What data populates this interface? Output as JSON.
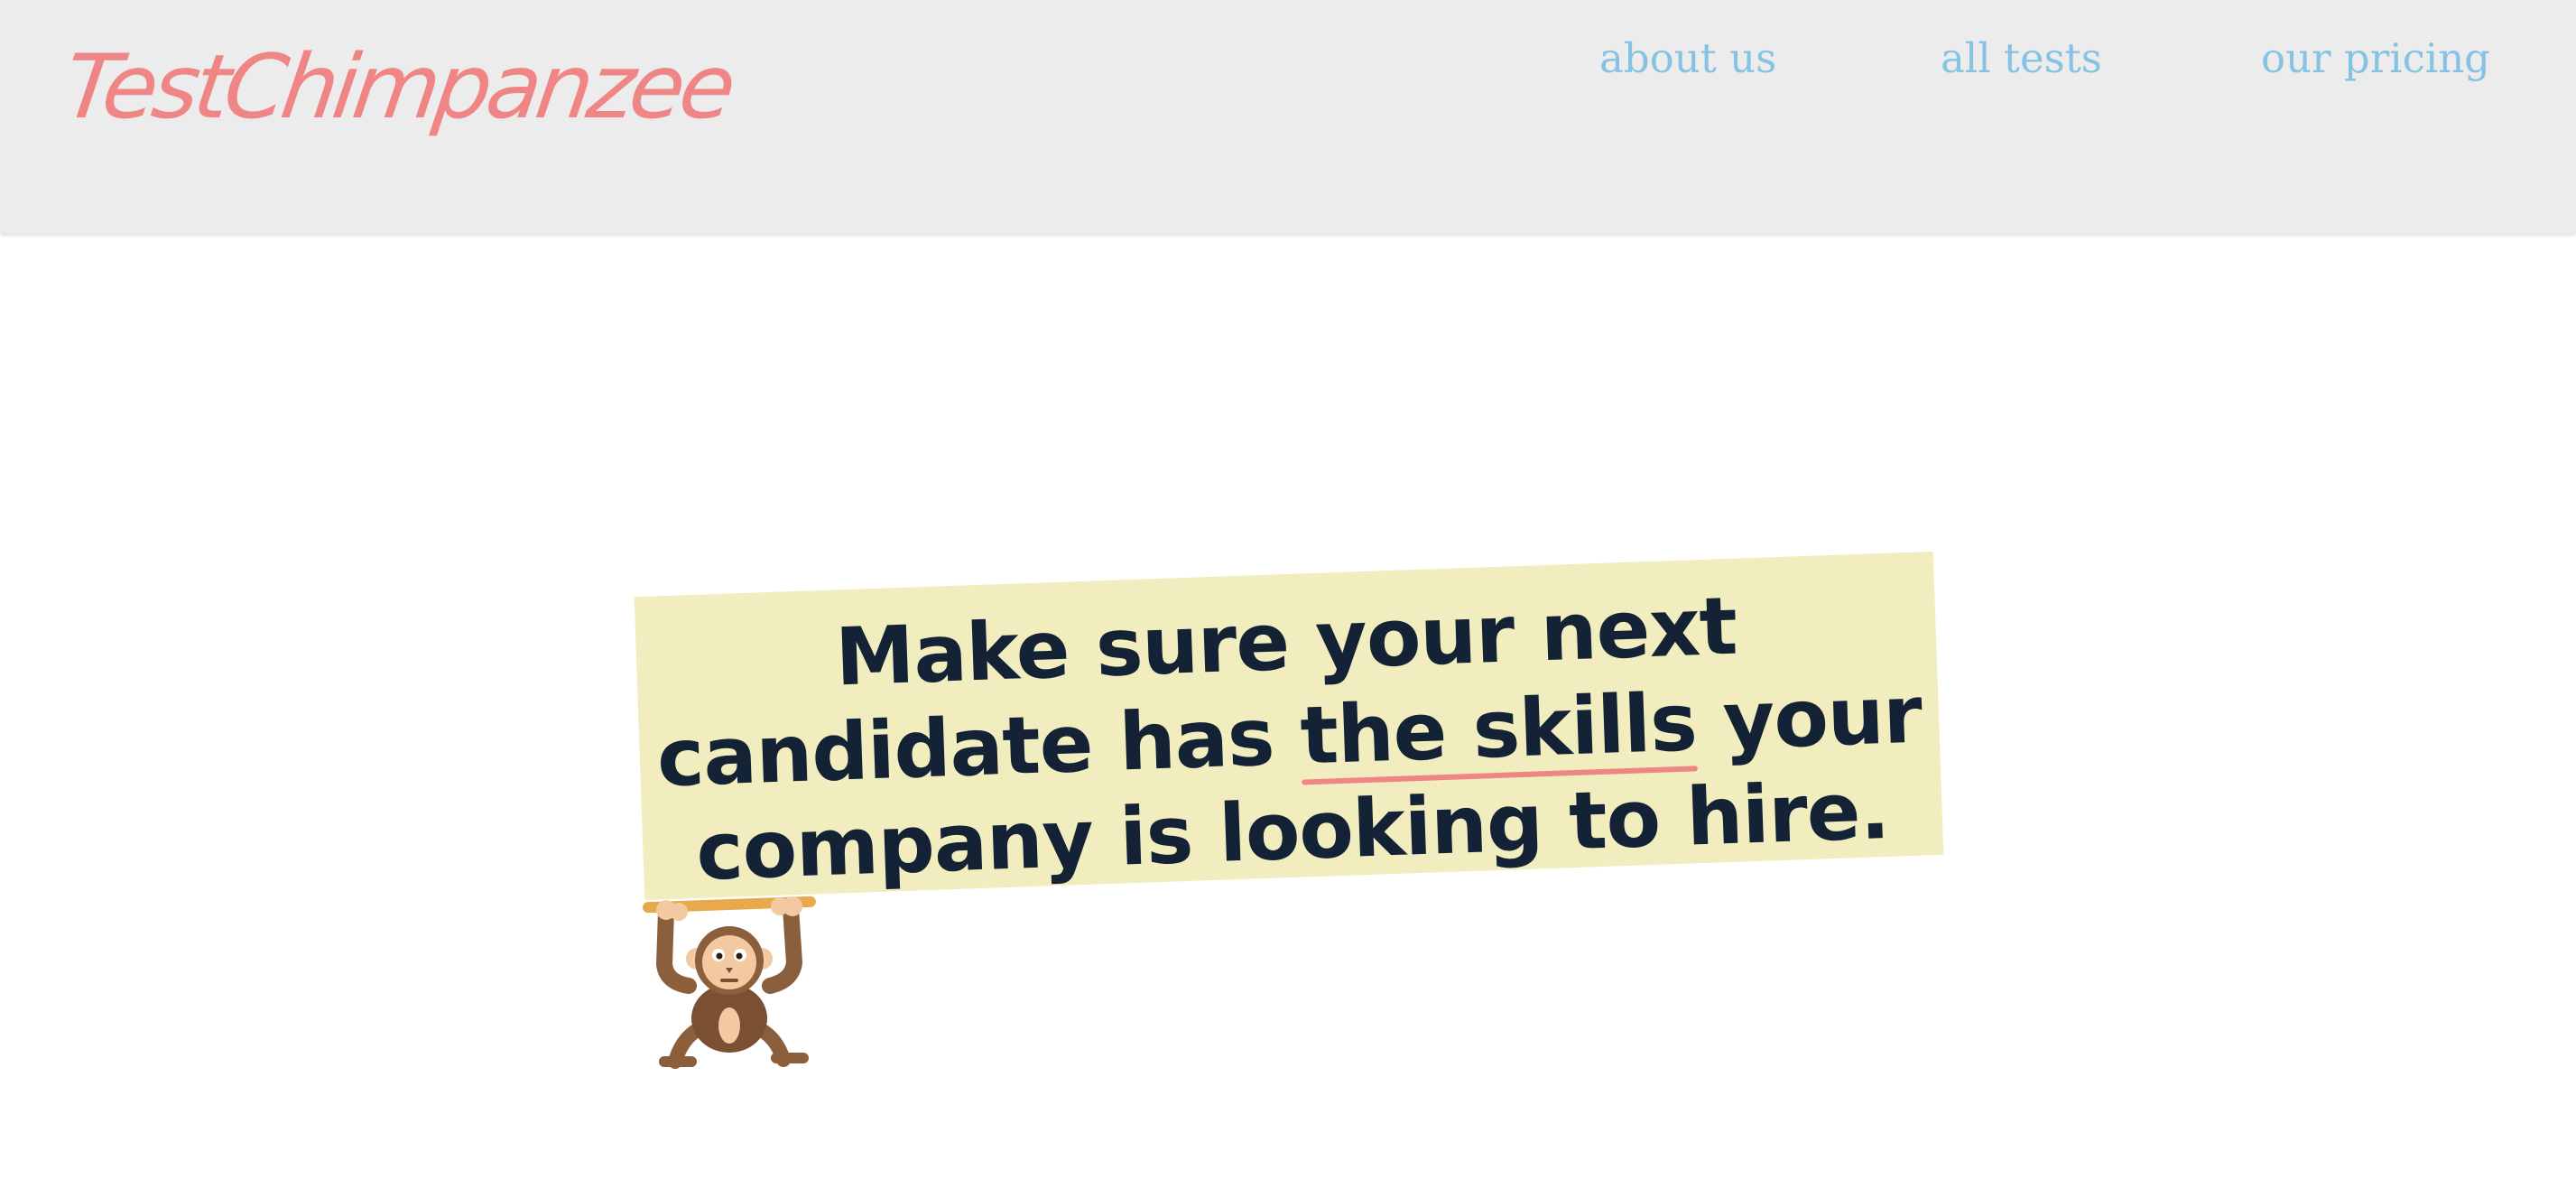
{
  "header": {
    "logo": "TestChimpanzee",
    "nav": [
      {
        "label": "about us"
      },
      {
        "label": "all tests"
      },
      {
        "label": "our pricing"
      }
    ]
  },
  "hero": {
    "headline_before": "Make sure your next candidate has ",
    "headline_highlight": "the skills",
    "headline_after": " your company is looking to hire."
  },
  "colors": {
    "header_bg": "#ececec",
    "logo": "#ef8585",
    "nav_link": "#86c3e2",
    "sign_bg": "#f2edbe",
    "headline_text": "#132235",
    "underline": "#ef8585",
    "bar": "#e8a94c",
    "monkey_fur": "#8b5e3c",
    "monkey_face": "#f2c9a0"
  },
  "icons": {
    "mascot": "hanging-monkey-icon"
  }
}
